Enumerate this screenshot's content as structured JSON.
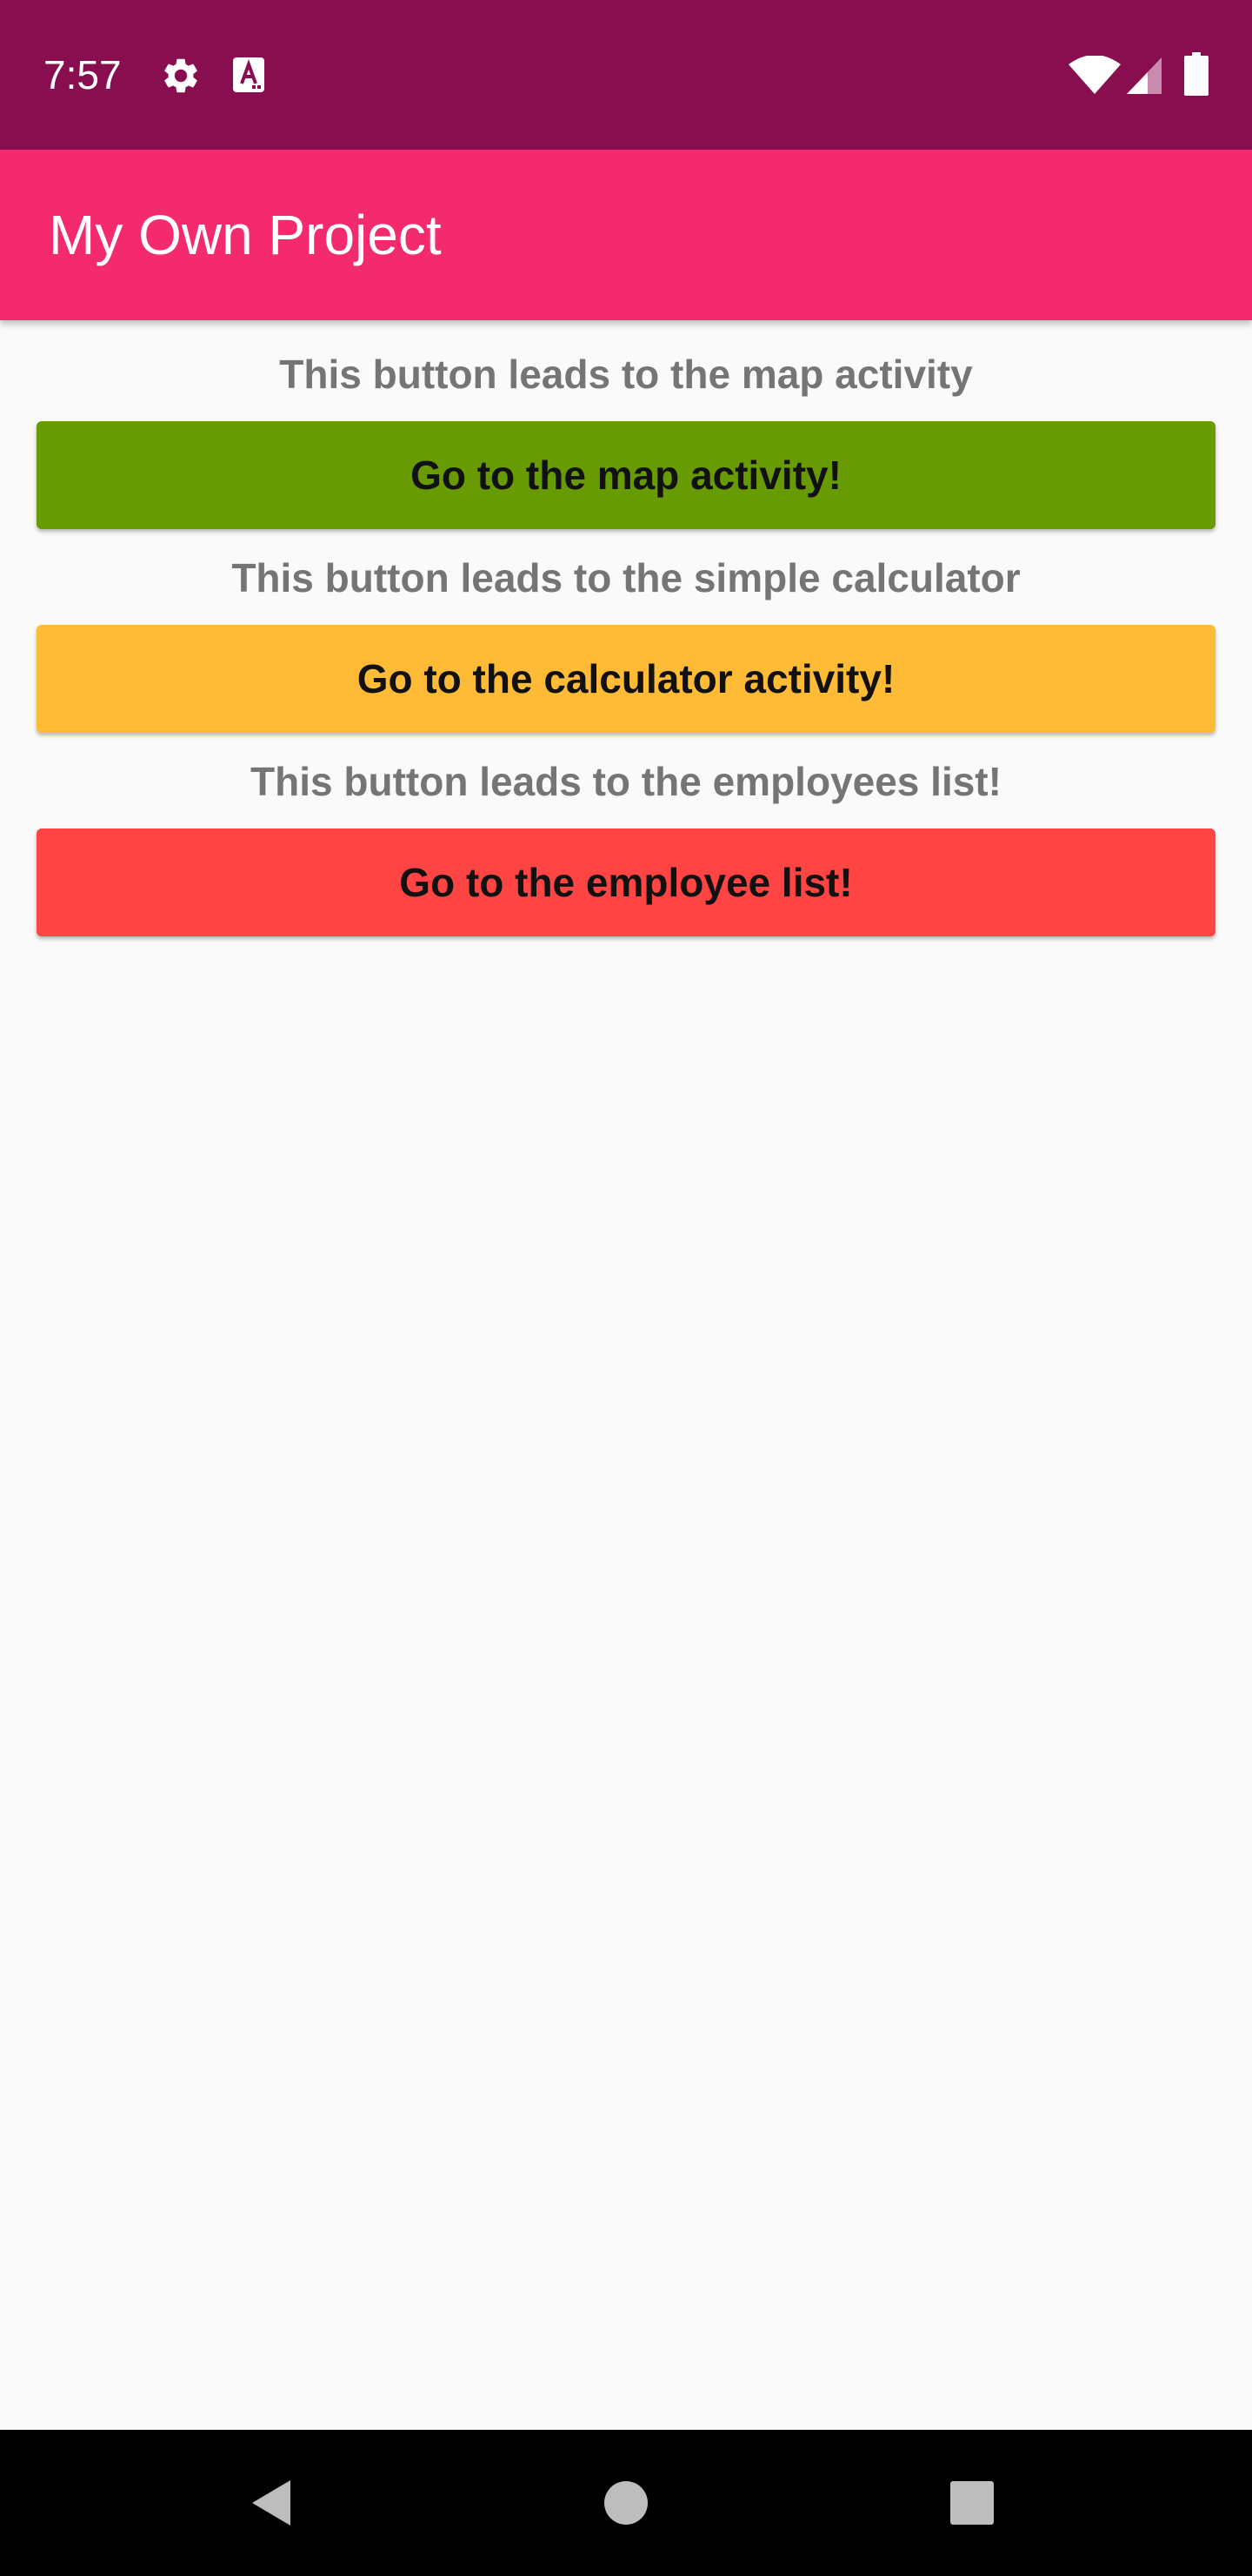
{
  "status_bar": {
    "time": "7:57",
    "icons": [
      "gear-icon",
      "font-icon",
      "wifi-icon",
      "cell-signal-icon",
      "battery-icon"
    ],
    "background_color": "#880e4f"
  },
  "app_bar": {
    "title": "My Own Project",
    "background_color": "#f32a6e"
  },
  "main": {
    "sections": [
      {
        "caption": "This button leads to the map activity",
        "button_label": "Go to the map activity!",
        "button_color": "#689a02"
      },
      {
        "caption": "This button leads to the simple calculator",
        "button_label": "Go to the calculator activity!",
        "button_color": "#ffbb36"
      },
      {
        "caption": "This button leads to the employees list!",
        "button_label": "Go to the employee list!",
        "button_color": "#ff4444"
      }
    ]
  },
  "nav_bar": {
    "icons": [
      "back-icon",
      "home-icon",
      "recents-icon"
    ]
  }
}
